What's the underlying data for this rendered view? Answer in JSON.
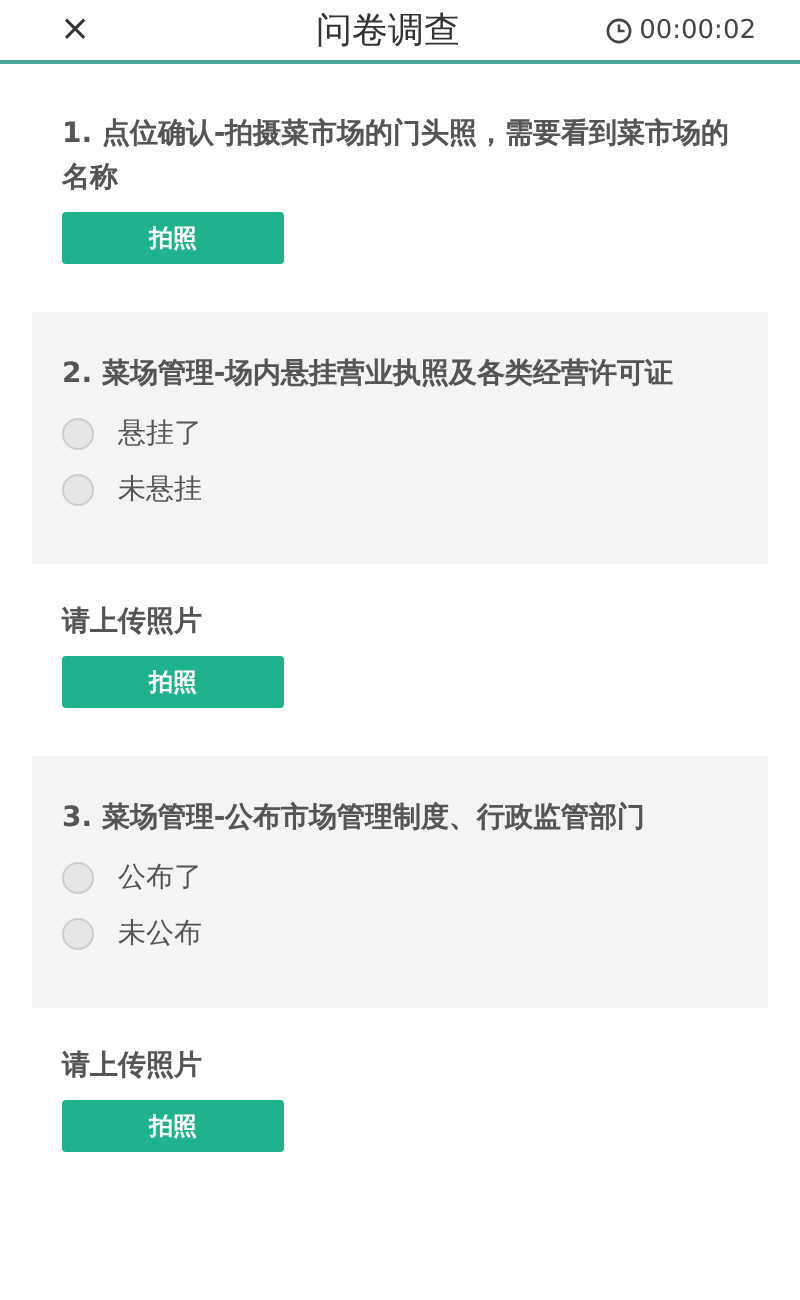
{
  "header": {
    "close": "×",
    "title": "问卷调查",
    "timer": "00:00:02"
  },
  "sections": [
    {
      "kind": "photo",
      "label": "1. 点位确认-拍摄菜市场的门头照，需要看到菜市场的名称",
      "button": "拍照"
    },
    {
      "kind": "choice",
      "label": "2. 菜场管理-场内悬挂营业执照及各类经营许可证",
      "options": [
        {
          "label": "悬挂了",
          "selected": false
        },
        {
          "label": "未悬挂",
          "selected": false
        }
      ]
    },
    {
      "kind": "photo",
      "label": "请上传照片",
      "button": "拍照"
    },
    {
      "kind": "choice",
      "label": "3. 菜场管理-公布市场管理制度、行政监管部门",
      "options": [
        {
          "label": "公布了",
          "selected": false
        },
        {
          "label": "未公布",
          "selected": false
        }
      ]
    },
    {
      "kind": "photo",
      "label": "请上传照片",
      "button": "拍照"
    }
  ]
}
